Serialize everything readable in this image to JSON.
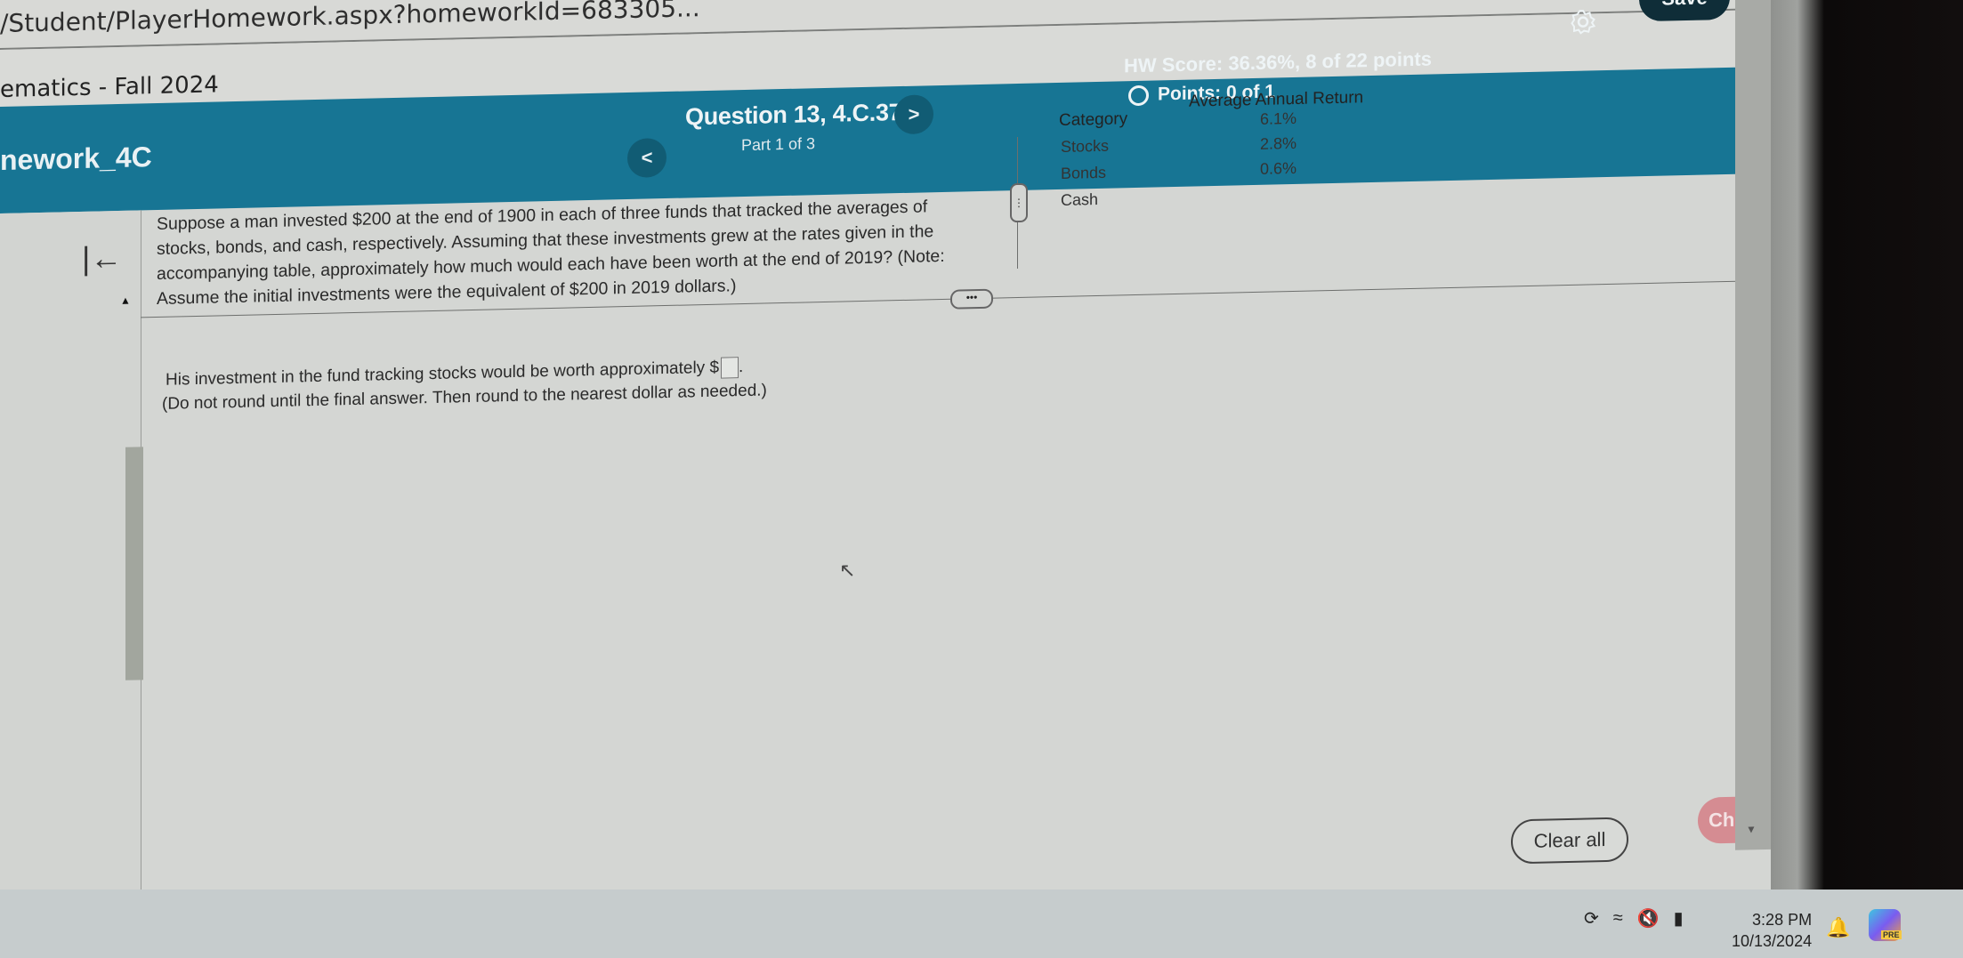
{
  "browser": {
    "url": "/Student/PlayerHomework.aspx?homeworkId=683305..."
  },
  "course": {
    "title": "ematics - Fall 2024"
  },
  "header": {
    "homework_title": "nework_4C",
    "question_title": "Question 13, 4.C.37",
    "part": "Part 1 of 3",
    "prev_label": "<",
    "next_label": ">",
    "hw_score": "HW Score: 36.36%, 8 of 22 points",
    "points": "Points: 0 of 1",
    "save_label": "Save",
    "accent_color": "#177594"
  },
  "question": {
    "prompt": "Suppose a man invested $200 at the end of 1900 in each of three funds that tracked the averages of stocks, bonds, and cash, respectively. Assuming that these investments grew at the rates given in the accompanying table, approximately how much would each have been worth at the end of 2019? (Note: Assume the initial investments were the equivalent of $200 in 2019 dollars.)",
    "answer_prefix": "His investment in the fund tracking stocks would be worth approximately $",
    "answer_value": "",
    "answer_suffix": ".",
    "note": "(Do not round until the final answer. Then round to the nearest dollar as needed.)",
    "more_label": "•••"
  },
  "table": {
    "headers": [
      "Category",
      "Average Annual Return"
    ],
    "rows": [
      {
        "category": "Stocks",
        "return": "6.1%"
      },
      {
        "category": "Bonds",
        "return": "2.8%"
      },
      {
        "category": "Cash",
        "return": "0.6%"
      }
    ]
  },
  "actions": {
    "clear_all": "Clear all",
    "check_answer": "Check answer",
    "check_color": "#d58c92"
  },
  "taskbar": {
    "time": "3:28 PM",
    "date": "10/13/2024",
    "copilot_badge": "PRE"
  }
}
